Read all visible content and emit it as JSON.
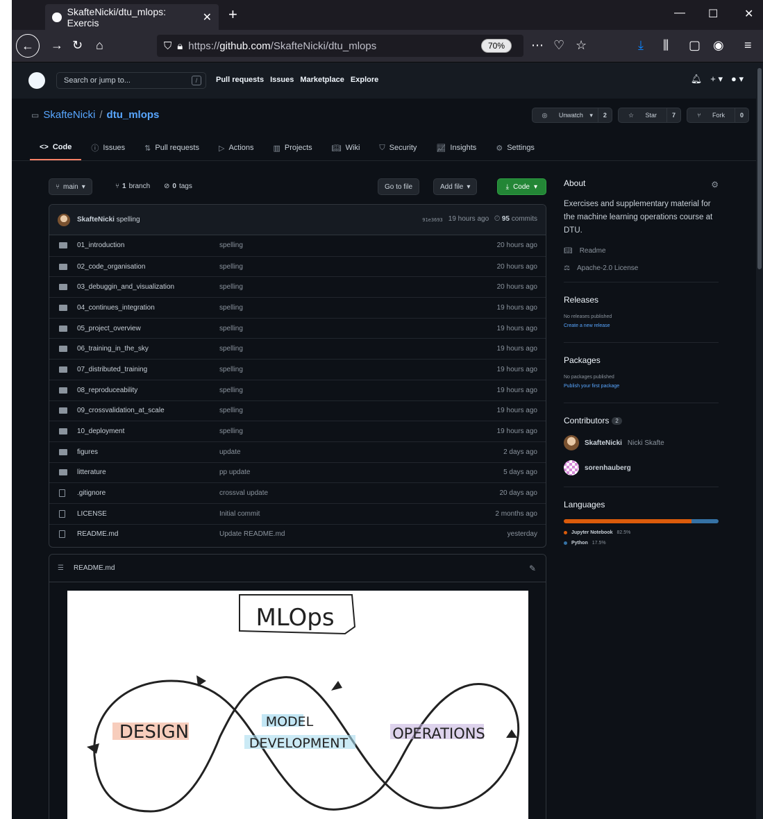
{
  "browser": {
    "tab_title": "SkafteNicki/dtu_mlops: Exercis",
    "url_prefix": "https://",
    "url_host": "github.com",
    "url_path": "/SkafteNicki/dtu_mlops",
    "zoom": "70%"
  },
  "header": {
    "search_placeholder": "Search or jump to...",
    "search_shortcut": "/",
    "nav": [
      "Pull requests",
      "Issues",
      "Marketplace",
      "Explore"
    ]
  },
  "repo": {
    "owner": "SkafteNicki",
    "separator": "/",
    "name": "dtu_mlops",
    "watch_label": "Unwatch",
    "watch_count": "2",
    "star_label": "Star",
    "star_count": "7",
    "fork_label": "Fork",
    "fork_count": "0",
    "tabs": [
      "Code",
      "Issues",
      "Pull requests",
      "Actions",
      "Projects",
      "Wiki",
      "Security",
      "Insights",
      "Settings"
    ]
  },
  "branchbar": {
    "branch": "main",
    "branch_count": "1",
    "branch_word": "branch",
    "tag_count": "0",
    "tag_word": "tags",
    "go_to_file": "Go to file",
    "add_file": "Add file",
    "code": "Code"
  },
  "commit": {
    "author": "SkafteNicki",
    "message": "spelling",
    "hash": "91e3693",
    "time": "19 hours ago",
    "count": "95",
    "count_word": "commits"
  },
  "files": [
    {
      "name": "01_introduction",
      "msg": "spelling",
      "age": "20 hours ago",
      "dir": true
    },
    {
      "name": "02_code_organisation",
      "msg": "spelling",
      "age": "20 hours ago",
      "dir": true
    },
    {
      "name": "03_debuggin_and_visualization",
      "msg": "spelling",
      "age": "20 hours ago",
      "dir": true
    },
    {
      "name": "04_continues_integration",
      "msg": "spelling",
      "age": "19 hours ago",
      "dir": true
    },
    {
      "name": "05_project_overview",
      "msg": "spelling",
      "age": "19 hours ago",
      "dir": true
    },
    {
      "name": "06_training_in_the_sky",
      "msg": "spelling",
      "age": "19 hours ago",
      "dir": true
    },
    {
      "name": "07_distributed_training",
      "msg": "spelling",
      "age": "19 hours ago",
      "dir": true
    },
    {
      "name": "08_reproduceability",
      "msg": "spelling",
      "age": "19 hours ago",
      "dir": true
    },
    {
      "name": "09_crossvalidation_at_scale",
      "msg": "spelling",
      "age": "19 hours ago",
      "dir": true
    },
    {
      "name": "10_deployment",
      "msg": "spelling",
      "age": "19 hours ago",
      "dir": true
    },
    {
      "name": "figures",
      "msg": "update",
      "age": "2 days ago",
      "dir": true
    },
    {
      "name": "litterature",
      "msg": "pp update",
      "age": "5 days ago",
      "dir": true
    },
    {
      "name": ".gitignore",
      "msg": "crossval update",
      "age": "20 days ago",
      "dir": false
    },
    {
      "name": "LICENSE",
      "msg": "Initial commit",
      "age": "2 months ago",
      "dir": false
    },
    {
      "name": "README.md",
      "msg": "Update README.md",
      "age": "yesterday",
      "dir": false
    }
  ],
  "readme": {
    "title": "README.md",
    "image_text": {
      "title": "MLOps",
      "left": "DESIGN",
      "mid1": "MODEL",
      "mid2": "DEVELOPMENT",
      "right": "OPERATIONS"
    }
  },
  "about": {
    "heading": "About",
    "description": "Exercises and supplementary material for the machine learning operations course at DTU.",
    "readme": "Readme",
    "license": "Apache-2.0 License"
  },
  "releases": {
    "heading": "Releases",
    "none": "No releases published",
    "link": "Create a new release"
  },
  "packages": {
    "heading": "Packages",
    "none": "No packages published",
    "link": "Publish your first package"
  },
  "contributors": {
    "heading": "Contributors",
    "count": "2",
    "people": [
      {
        "login": "SkafteNicki",
        "name": "Nicki Skafte"
      },
      {
        "login": "sorenhauberg",
        "name": ""
      }
    ]
  },
  "languages": {
    "heading": "Languages",
    "items": [
      {
        "name": "Jupyter Notebook",
        "pct": "82.5%",
        "value": 82.5,
        "color": "#DA5B0B"
      },
      {
        "name": "Python",
        "pct": "17.5%",
        "value": 17.5,
        "color": "#3572A5"
      }
    ]
  }
}
